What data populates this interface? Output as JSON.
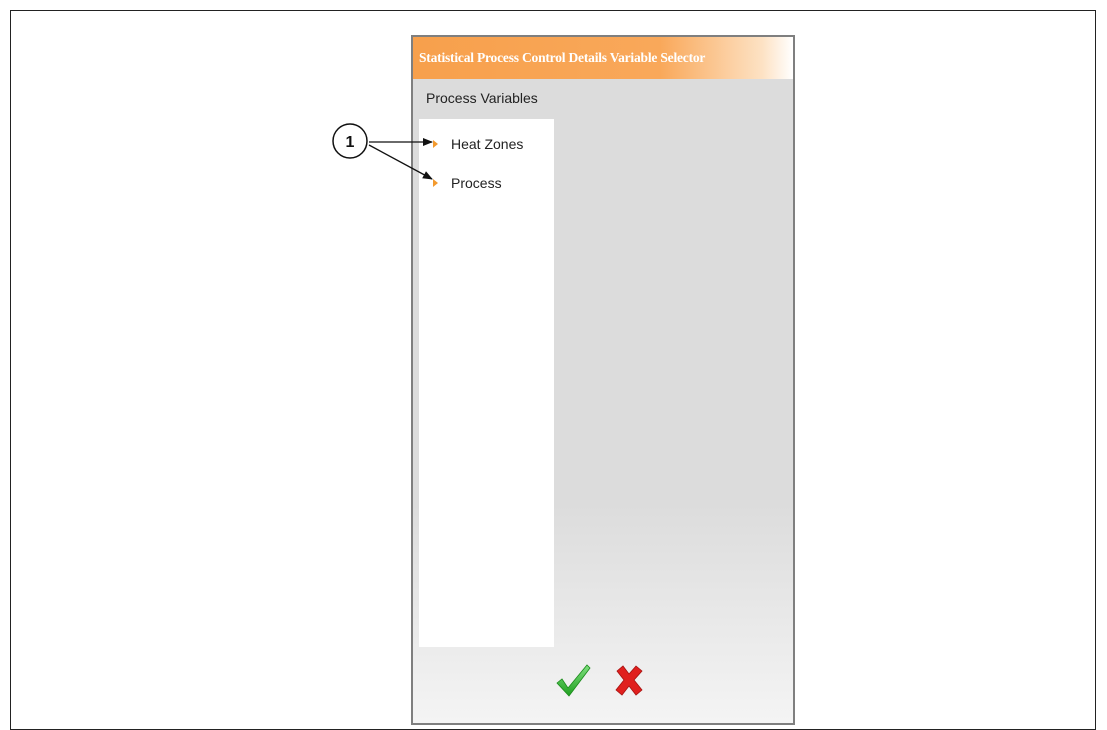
{
  "dialog": {
    "title": "Statistical Process Control Details Variable Selector",
    "section_label": "Process Variables",
    "variables": [
      {
        "label": "Heat Zones"
      },
      {
        "label": "Process"
      }
    ],
    "accept_icon": "checkmark-icon",
    "cancel_icon": "close-x-icon"
  },
  "callout": {
    "number": "1"
  },
  "colors": {
    "title_bar": "#f7a04c",
    "arrow": "#f39a2e",
    "accept": "#3cc43c",
    "cancel": "#e0201e"
  }
}
